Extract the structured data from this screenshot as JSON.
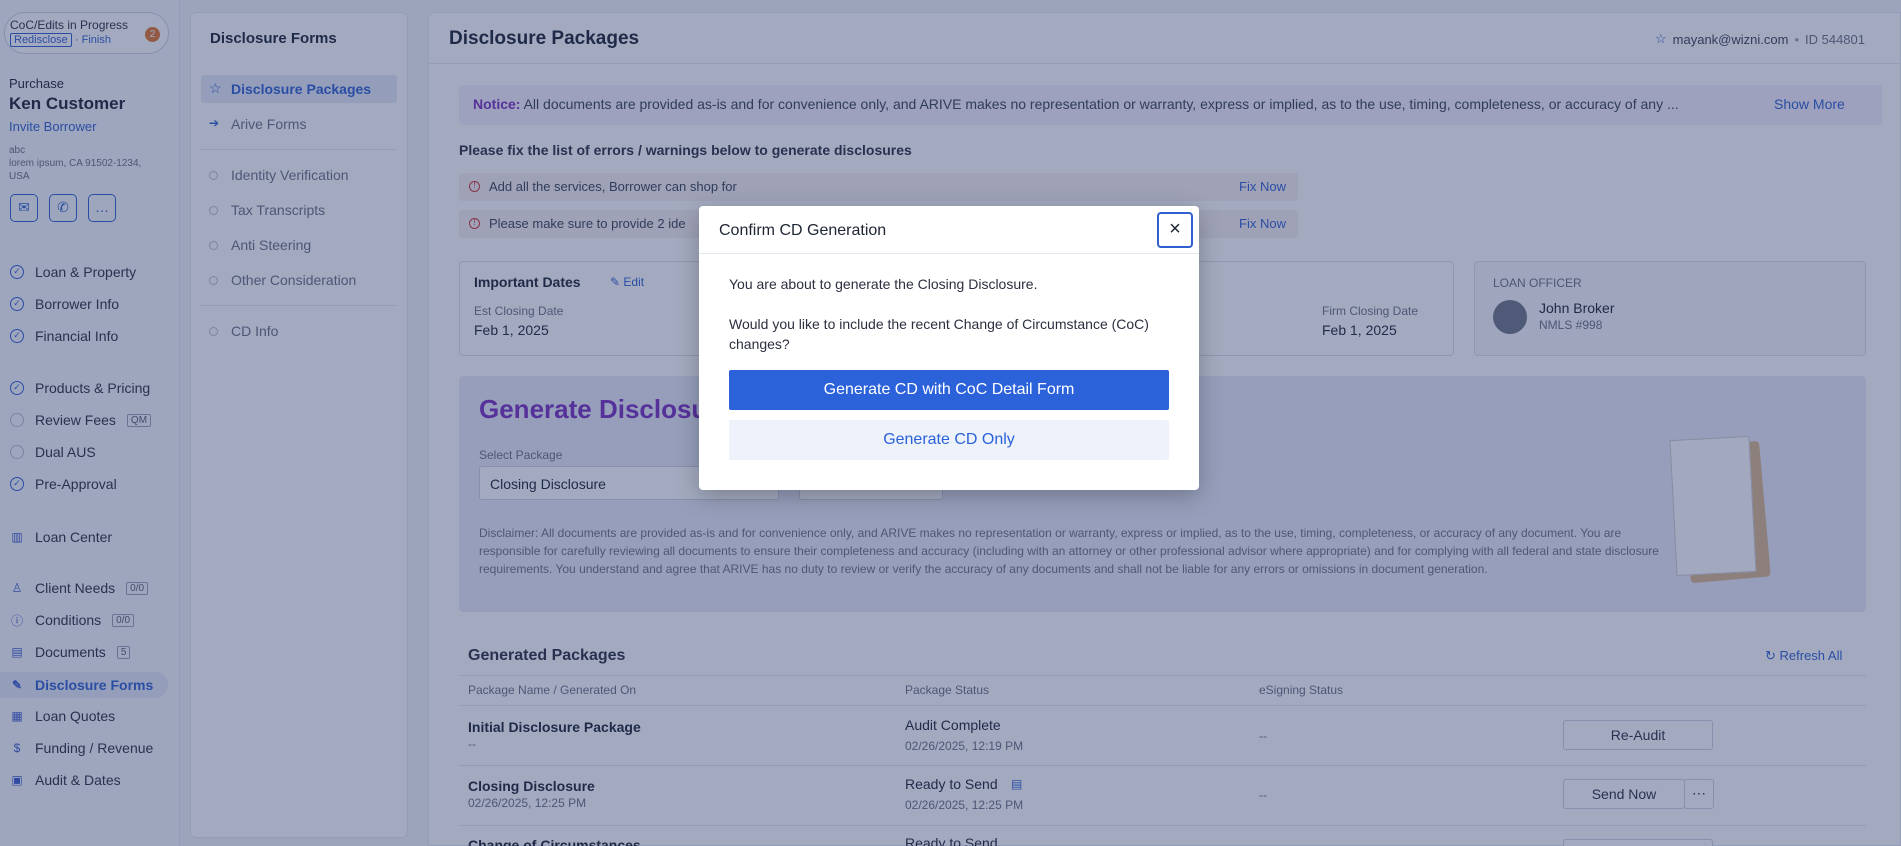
{
  "sidebar": {
    "coc_title": "CoC/Edits in Progress",
    "coc_redisclose": "Redisclose",
    "coc_finish": "Finish",
    "coc_count": "2",
    "loan_type": "Purchase",
    "borrower_name": "Ken Customer",
    "invite_label": "Invite Borrower",
    "address_line1": "abc",
    "address_line2": "lorem ipsum, CA 91502-1234,",
    "address_line3": "USA",
    "items": [
      {
        "label": "Loan & Property"
      },
      {
        "label": "Borrower Info"
      },
      {
        "label": "Financial Info"
      },
      {
        "label": "Products & Pricing"
      },
      {
        "label": "Review Fees",
        "badge": "QM"
      },
      {
        "label": "Dual AUS"
      },
      {
        "label": "Pre-Approval"
      },
      {
        "label": "Loan Center"
      },
      {
        "label": "Client Needs",
        "badge": "0/0"
      },
      {
        "label": "Conditions",
        "badge": "0/0"
      },
      {
        "label": "Documents",
        "badge": "5"
      },
      {
        "label": "Disclosure Forms"
      },
      {
        "label": "Loan Quotes"
      },
      {
        "label": "Funding / Revenue"
      },
      {
        "label": "Audit & Dates"
      }
    ]
  },
  "secnav": {
    "title": "Disclosure Forms",
    "items": [
      {
        "label": "Disclosure Packages"
      },
      {
        "label": "Arive Forms"
      },
      {
        "label": "Identity Verification"
      },
      {
        "label": "Tax Transcripts"
      },
      {
        "label": "Anti Steering"
      },
      {
        "label": "Other Consideration"
      },
      {
        "label": "CD Info"
      }
    ]
  },
  "header": {
    "title": "Disclosure Packages",
    "user_email": "mayank@wizni.com",
    "separator": "•",
    "user_id": "ID 544801"
  },
  "notice": {
    "label": "Notice:",
    "text": "All documents are provided as-is and for convenience only, and ARIVE makes no representation or warranty, express or implied, as to the use, timing, completeness, or accuracy of any ...",
    "show_more": "Show More"
  },
  "errors": {
    "heading": "Please fix the list of errors / warnings below to generate disclosures",
    "items": [
      {
        "text": "Add all the services, Borrower can shop for",
        "action": "Fix Now"
      },
      {
        "text": "Please make sure to provide 2 ide",
        "action": "Fix Now"
      }
    ]
  },
  "dates": {
    "title": "Important Dates",
    "edit": "Edit",
    "est_label": "Est Closing Date",
    "est_value": "Feb 1, 2025",
    "firm_label": "Firm Closing Date",
    "firm_value": "Feb 1, 2025"
  },
  "loan_officer": {
    "label": "LOAN OFFICER",
    "name": "John Broker",
    "nmls": "NMLS #998"
  },
  "generate": {
    "title": "Generate Disclosur",
    "select_label": "Select Package",
    "select_value": "Closing Disclosure",
    "disclaimer": "Disclaimer: All documents are provided as-is and for convenience only, and ARIVE makes no representation or warranty, express or implied, as to the use, timing, completeness, or accuracy of any document. You are responsible for carefully reviewing all documents to ensure their completeness and accuracy (including with an attorney or other professional advisor where appropriate) and for complying with all federal and state disclosure requirements. You understand and agree that ARIVE has no duty to review or verify the accuracy of any documents and shall not be liable for any errors or omissions in document generation."
  },
  "packages": {
    "title": "Generated Packages",
    "refresh": "Refresh All",
    "columns": [
      "Package Name / Generated On",
      "Package Status",
      "eSigning Status"
    ],
    "rows": [
      {
        "name": "Initial Disclosure Package",
        "date": "--",
        "status": "Audit Complete",
        "status_date": "02/26/2025, 12:19 PM",
        "esign": "--",
        "action": "Re-Audit"
      },
      {
        "name": "Closing Disclosure",
        "date": "02/26/2025, 12:25 PM",
        "status": "Ready to Send",
        "status_date": "02/26/2025, 12:25 PM",
        "esign": "--",
        "action": "Send Now"
      },
      {
        "name": "Change of Circumstances",
        "date": "",
        "status": "Ready to Send",
        "status_date": "",
        "esign": "",
        "action": ""
      }
    ]
  },
  "modal": {
    "title": "Confirm CD Generation",
    "close": "×",
    "text1": "You are about to generate the Closing Disclosure.",
    "text2": "Would you like to include the recent Change of Circumstance (CoC) changes?",
    "primary": "Generate CD with CoC Detail Form",
    "secondary": "Generate CD Only"
  },
  "colors": {
    "accent": "#2b62d9",
    "overlay": "#243466"
  }
}
